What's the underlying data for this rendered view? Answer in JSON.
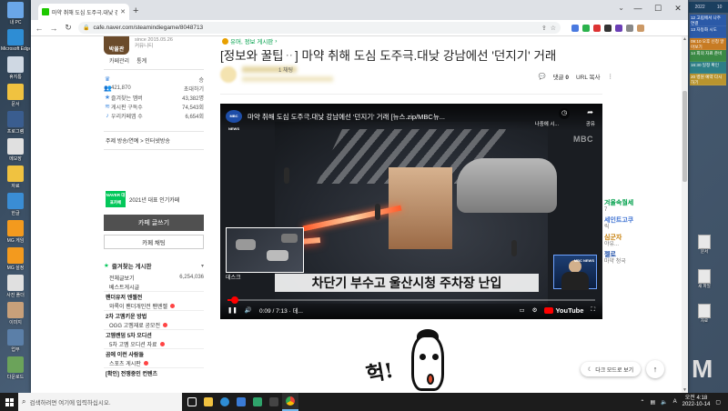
{
  "desktop": {
    "left_icons": [
      {
        "label": "내 PC"
      },
      {
        "label": "Microsoft Edge"
      },
      {
        "label": "휴지통"
      },
      {
        "label": "문서"
      },
      {
        "label": "프로그램"
      },
      {
        "label": "메모장"
      },
      {
        "label": "자료"
      },
      {
        "label": "한글"
      },
      {
        "label": "MG 게임"
      },
      {
        "label": "MG 설정"
      },
      {
        "label": "사진 폴더"
      },
      {
        "label": "이미지"
      },
      {
        "label": "업무"
      },
      {
        "label": "다운로드"
      }
    ],
    "right_panel": {
      "header": [
        "2022",
        "10"
      ],
      "items": [
        {
          "text": "12 고립에서 나주 연결",
          "color": "blue"
        },
        {
          "text": "13 자동화 시도",
          "color": "blue"
        },
        {
          "text": "09:10 오후 신청 알아보기",
          "color": "orange"
        },
        {
          "text": "14 회의 자료 준비",
          "color": "green"
        },
        {
          "text": "16:30 일정 확인",
          "color": "teal"
        },
        {
          "text": "20 병원 예약 다시 하기",
          "color": "yellow"
        }
      ]
    },
    "right_icons": [
      {
        "label": "문서"
      },
      {
        "label": "새 파일"
      },
      {
        "label": "자료"
      }
    ],
    "partial_mark": "M"
  },
  "browser": {
    "tab": {
      "title": "마약 취해 도심 도주극.대낮 강남에서 '던지기' 거래"
    },
    "url": "cafe.naver.com/steamindiegame/8048713"
  },
  "cafe": {
    "logo_text": "박물관",
    "since": "since 2015.05.26",
    "cafe_type": "커뮤니티",
    "links": [
      "카페관리",
      "통계"
    ],
    "members": [
      {
        "icon": "crown-icon",
        "key": "",
        "value": "승"
      },
      {
        "icon": "member-icon",
        "key": "421,870",
        "value": "초대하기"
      },
      {
        "icon": "star-icon",
        "key": "즐겨찾는 멤버",
        "value": "43,382명"
      },
      {
        "icon": "rss-icon",
        "key": "게시판 구독수",
        "value": "74,543회"
      },
      {
        "icon": "bell-icon",
        "key": "우리카페앱 수",
        "value": "6,654회"
      }
    ],
    "menu_line": "주제 방송/연예 > 인터넷방송",
    "naver_badge": "NAVER 대표카페",
    "naver_badge_text": "2021년 대표 인기카페",
    "write_button": "카페 글쓰기",
    "chat_button": "카페 채팅",
    "fav_board": {
      "title": "즐겨찾는 게시판"
    },
    "boards": [
      {
        "type": "item",
        "label": "전체글보기",
        "count": "6,254,036",
        "new": false
      },
      {
        "type": "item",
        "label": "베스트게시글",
        "count": "",
        "new": false
      },
      {
        "type": "section",
        "label": "팬더유저 엔젤전"
      },
      {
        "type": "item",
        "label": "와록이 팬더개인전 팬엔젤",
        "count": "",
        "new": true
      },
      {
        "type": "section",
        "label": "2차 고멤키운 방법"
      },
      {
        "type": "item",
        "label": "OGG 고멤재료 공모전",
        "count": "",
        "new": true
      },
      {
        "type": "section",
        "label": "고멤랜덤 5차 오디션"
      },
      {
        "type": "item",
        "label": "5차 고멤 오디션 자료",
        "count": "",
        "new": true
      },
      {
        "type": "section",
        "label": "곰에 이런 사람들"
      },
      {
        "type": "item",
        "label": "스포츠 게시판",
        "count": "",
        "new": true
      },
      {
        "type": "section",
        "label": "[확인] 전쟁중인 컨텐츠"
      }
    ]
  },
  "article": {
    "crumb": "유머, 정보 게시판",
    "title": "[정보와 꿀팁ᆢ] 마약 취해 도심 도주극.대낮 강남에선 '던지기' 거래",
    "author_tag": "1 채팅",
    "actions": {
      "comment_label": "댓글",
      "comment_count": "0",
      "url_label": "URL 복사",
      "more": "⋮"
    }
  },
  "video": {
    "channel": "MBC NEWS",
    "title": "마약 취해 도심 도주극.대낮 강남에선 '던지기' 거래 [뉴스.zip/MBC뉴...",
    "watch_later": "나중에 시...",
    "share": "공유",
    "watermark": "MBC",
    "caption": "차단기 부수고 울산시청 주차장 난입",
    "ticker": "데스크",
    "current_time": "0:09",
    "duration": "7:13",
    "chapter": "데...",
    "progress": 0.02,
    "platform": "YouTube"
  },
  "comic": {
    "exclaim": "헉!"
  },
  "side_float": [
    {
      "name": "겨울속월세",
      "sub": "7",
      "color": "#00a04b"
    },
    {
      "name": "세인트고쿠",
      "sub": "릭",
      "color": "#3b6fd1"
    },
    {
      "name": "심군자",
      "sub": "야유...",
      "color": "#c47a00"
    },
    {
      "name": "젤로",
      "sub": "마약 청국",
      "color": "#1e4ea8"
    }
  ],
  "dark_mode_label": "다크 모드로 보기",
  "taskbar": {
    "search_placeholder": "검색하려면 여기에 입력하십시오.",
    "time": "오전 4:18",
    "date": "2022-10-14"
  },
  "colors": {
    "naver_green": "#03c75a",
    "yt_red": "#ff0000",
    "desktop": "#3d4f63"
  }
}
